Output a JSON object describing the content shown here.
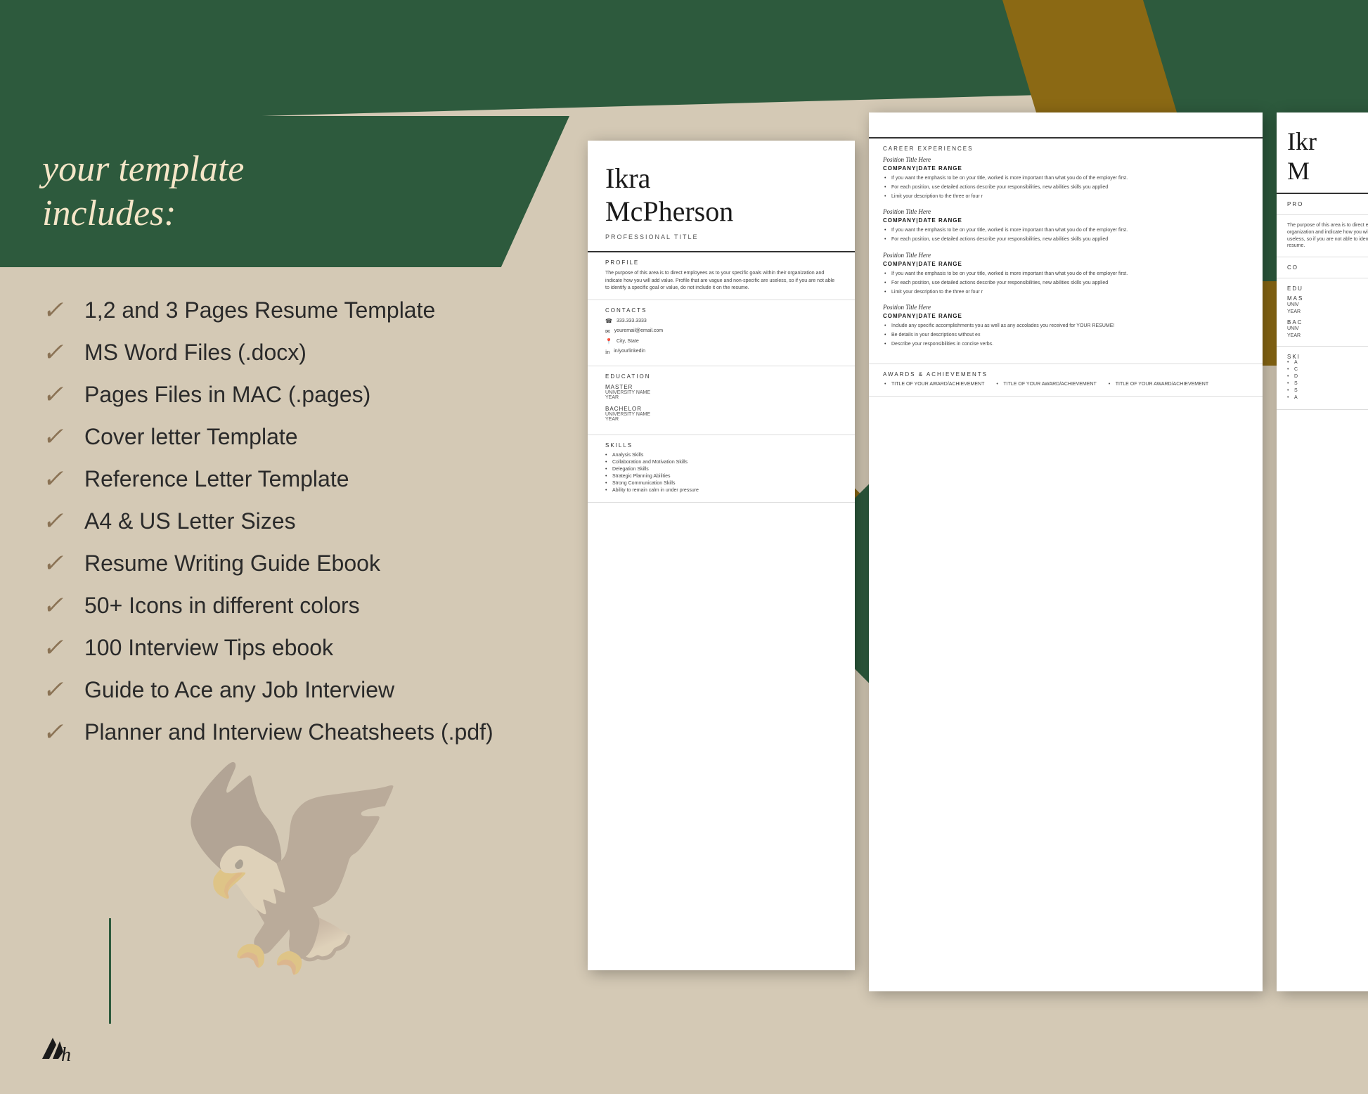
{
  "background": {
    "color": "#d4c9b5"
  },
  "banner": {
    "text": "your template\nincludes:",
    "line1": "your template",
    "line2": "includes:"
  },
  "checklist": {
    "items": [
      "1,2 and 3 Pages Resume Template",
      "MS Word Files (.docx)",
      "Pages Files in MAC (.pages)",
      "Cover letter Template",
      "Reference Letter Template",
      "A4 & US Letter Sizes",
      "Resume Writing Guide Ebook",
      "50+ Icons in different colors",
      "100 Interview Tips ebook",
      "Guide to Ace any Job Interview",
      "Planner and Interview Cheatsheets (.pdf)"
    ]
  },
  "resume1": {
    "name_first": "Ikra",
    "name_last": "McPherson",
    "professional_title": "PROFESSIONAL TITLE",
    "profile_title": "PROFILE",
    "profile_text": "The purpose of this area is to direct employees as to your specific goals within their organization and indicate how you will add value. Profile that are vague and non-specific are useless, so if you are not able to identify a specific goal or value, do not include it on the resume.",
    "contacts_title": "CONTACTS",
    "phone": "333.333.3333",
    "email": "youremail@email.com",
    "location": "City, State",
    "linkedin": "in/yourlinkedin",
    "education_title": "EDUCATION",
    "edu_master_label": "MASTER",
    "edu_master_university": "UNIVERSITY NAME",
    "edu_master_year": "YEAR",
    "edu_bachelor_label": "BACHELOR",
    "edu_bachelor_university": "UNIVERSITY NAME",
    "edu_bachelor_year": "YEAR",
    "skills_title": "SKILLS",
    "skills": [
      "Analysis Skills",
      "Collaboration and Motivation Skills",
      "Delegation Skills",
      "Strategic Planning Abilities",
      "Strong Communication Skills",
      "Ability to remain calm in under pressure"
    ]
  },
  "resume2": {
    "career_title": "CAREER EXPERIENCES",
    "positions": [
      {
        "title": "Position Title Here",
        "company": "COMPANY|DATE RANGE",
        "bullets": [
          "If you want the emphasis to be on your title, worked is more important than what you do of the employer first.",
          "For each position, use detailed actions describe your responsibilities, new abilities skills you applied",
          "Limit your description to the three or four r"
        ]
      },
      {
        "title": "Position Title Here",
        "company": "COMPANY|DATE RANGE",
        "bullets": [
          "If you want the emphasis to be on your title, worked is more important than what you do of the employer first.",
          "For each position, use detailed actions describe your responsibilities, new abilities skills you applied"
        ]
      },
      {
        "title": "Position Title Here",
        "company": "COMPANY|DATE RANGE",
        "bullets": [
          "If you want the emphasis to be on your title, worked is more important than what you do of the employer first.",
          "For each position, use detailed actions describe your responsibilities, new abilities skills you applied",
          "Limit your description to the three or four r"
        ]
      },
      {
        "title": "Position Title Here",
        "company": "COMPANY|DATE RANGE",
        "bullets": [
          "Include any specific accomplishments you as well as any accolades you received for YOUR RESUME!",
          "Be details in your descriptions without ex",
          "Describe your responsibilities in concise verbs."
        ]
      }
    ],
    "awards_title": "AWARDS & ACHIEVEMENTS",
    "awards": [
      "TITLE OF YOUR AWARD/ACHIEVEMENT",
      "TITLE OF YOUR AWARD/ACHIEVEMENT",
      "TITLE OF YOUR AWARD/ACHIEVEMENT"
    ]
  },
  "resume3": {
    "name_first": "Ikr",
    "name_second": "M",
    "profile_label": "PRO",
    "profile_body": "The purpose of this area is to direct employees as to your specific goals within their organization and indicate how you will add value. Profile that are vague and non-specific are useless, so if you are not able to identify a specific goal or value, do not include it on the resume.",
    "contacts_label": "CO",
    "education_label": "EDU",
    "mas_label": "MAS",
    "uni1": "UNIV",
    "year1": "YEAR",
    "bac_label": "BAC",
    "uni2": "UNIV",
    "year2": "YEAR",
    "skills_label": "SKI",
    "skills": [
      "A",
      "C",
      "D",
      "S",
      "S",
      "A"
    ]
  },
  "colors": {
    "dark_green": "#2d5a3d",
    "bronze": "#8b6914",
    "cream": "#d4c9b5",
    "text_dark": "#1a1a1a",
    "text_muted": "#555555"
  }
}
